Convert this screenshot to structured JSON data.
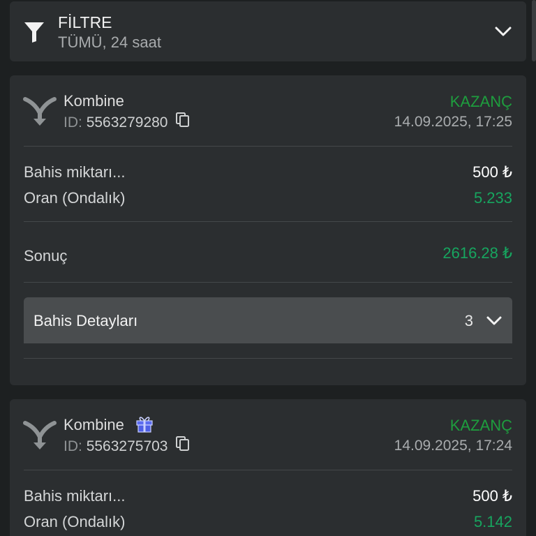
{
  "filter": {
    "title": "FİLTRE",
    "subtitle": "TÜMÜ, 24 saat",
    "icon": "filter-icon",
    "expand_icon": "chevron-down-icon"
  },
  "bets": [
    {
      "type": "Kombine",
      "id_label": "ID:",
      "id": "5563279280",
      "status": "KAZANÇ",
      "datetime": "14.09.2025, 17:25",
      "stake_label": "Bahis miktarı...",
      "stake": "500 ₺",
      "odds_label": "Oran (Ondalık)",
      "odds": "5.233",
      "result_label": "Sonuç",
      "result": "2616.28 ₺",
      "details_label": "Bahis Detayları",
      "details_count": "3"
    },
    {
      "type": "Kombine",
      "id_label": "ID:",
      "id": "5563275703",
      "status": "KAZANÇ",
      "datetime": "14.09.2025, 17:24",
      "stake_label": "Bahis miktarı...",
      "stake": "500 ₺",
      "odds_label": "Oran (Ondalık)",
      "odds": "5.142",
      "has_gift": true
    }
  ],
  "colors": {
    "win": "#1e9e3e",
    "value_green": "#17a55f",
    "card_bg": "#2b2e30",
    "page_bg": "#1d2021"
  }
}
